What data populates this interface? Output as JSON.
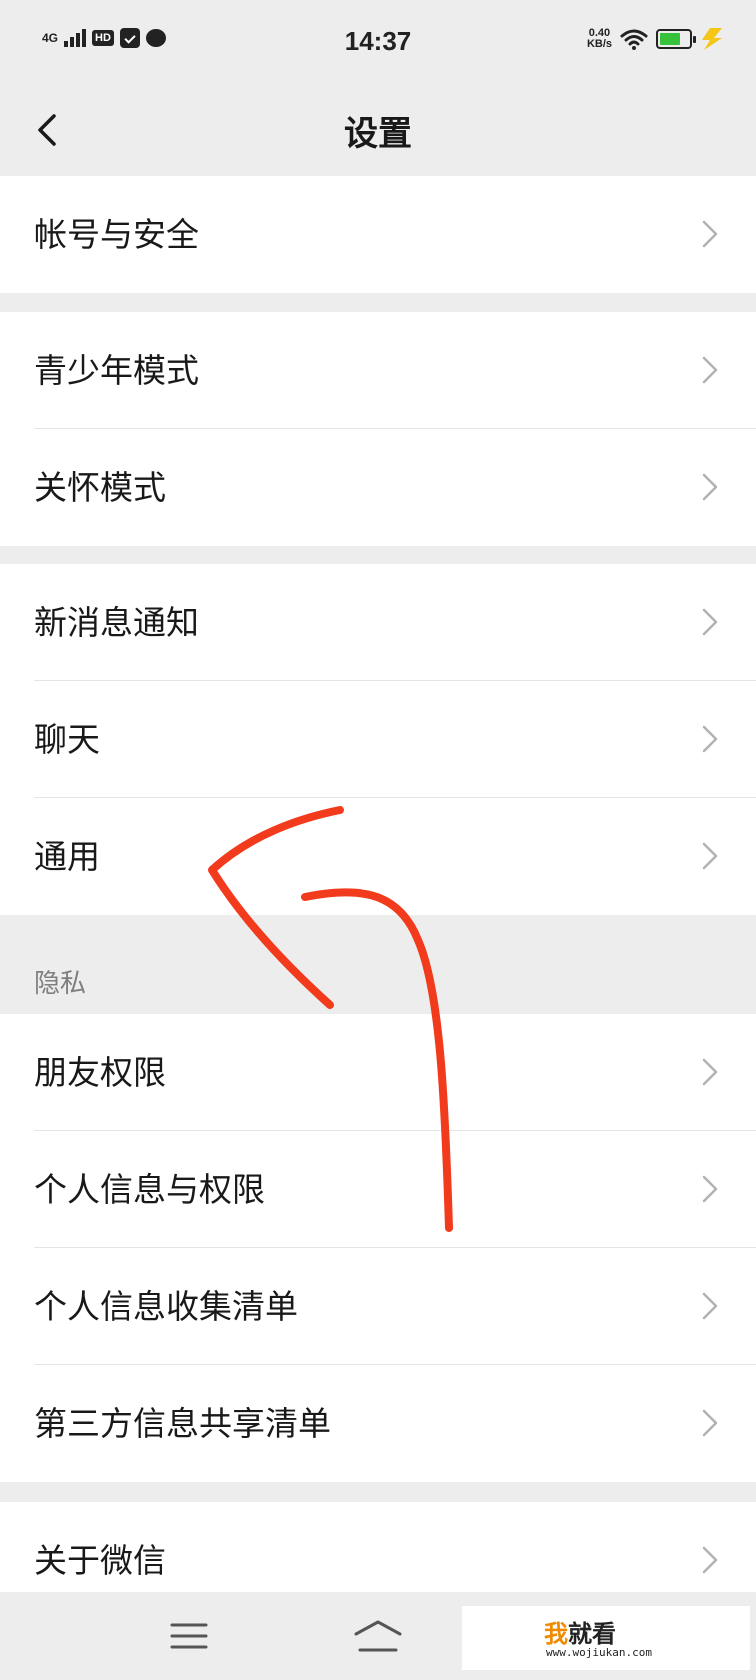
{
  "status_bar": {
    "network": "4G",
    "hd": "HD",
    "time": "14:37",
    "speed_value": "0.40",
    "speed_unit": "KB/s",
    "battery_level": 0.7,
    "battery_color": "#36c23a"
  },
  "header": {
    "title": "设置"
  },
  "groups": [
    {
      "items": [
        {
          "label": "帐号与安全"
        }
      ]
    },
    {
      "items": [
        {
          "label": "青少年模式"
        },
        {
          "label": "关怀模式"
        }
      ]
    },
    {
      "items": [
        {
          "label": "新消息通知"
        },
        {
          "label": "聊天"
        },
        {
          "label": "通用"
        }
      ]
    },
    {
      "header": "隐私",
      "items": [
        {
          "label": "朋友权限"
        },
        {
          "label": "个人信息与权限"
        },
        {
          "label": "个人信息收集清单"
        },
        {
          "label": "第三方信息共享清单"
        }
      ]
    },
    {
      "items": [
        {
          "label": "关于微信"
        }
      ]
    }
  ],
  "watermark": {
    "brand_first": "我",
    "brand_rest": "就看",
    "url": "www.wojiukan.com"
  },
  "colors": {
    "background": "#ededed",
    "annotation_arrow": "#f23a1c",
    "watermark_accent": "#f08a00"
  }
}
